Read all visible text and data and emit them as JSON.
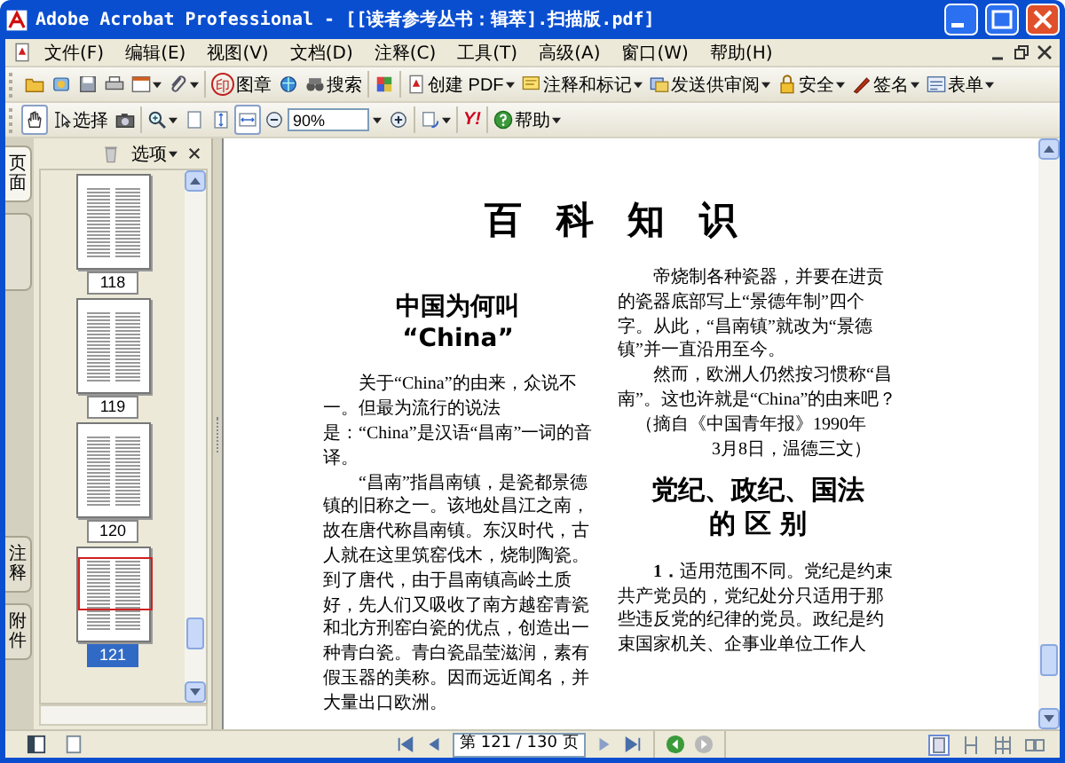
{
  "window": {
    "title": "Adobe Acrobat Professional - [[读者参考丛书：辑萃].扫描版.pdf]"
  },
  "menu_bar": {
    "items": [
      "文件(F)",
      "编辑(E)",
      "视图(V)",
      "文档(D)",
      "注释(C)",
      "工具(T)",
      "高级(A)",
      "窗口(W)",
      "帮助(H)"
    ]
  },
  "toolbar_1": {
    "items": [
      {
        "kind": "icon",
        "dropdown": false
      },
      {
        "kind": "icon",
        "dropdown": false
      },
      {
        "kind": "icon",
        "dropdown": false
      },
      {
        "kind": "icon",
        "dropdown": false
      },
      {
        "kind": "icon",
        "dropdown": true
      },
      {
        "kind": "icon",
        "dropdown": true
      },
      {
        "kind": "separator"
      },
      {
        "kind": "seal",
        "glyph": "印",
        "label": "图章",
        "dropdown": false
      },
      {
        "kind": "icon",
        "dropdown": false
      },
      {
        "kind": "labeled",
        "label": "搜索",
        "dropdown": false
      },
      {
        "kind": "separator"
      },
      {
        "kind": "icon",
        "dropdown": false
      },
      {
        "kind": "separator"
      },
      {
        "kind": "labeled",
        "label": "创建 PDF",
        "dropdown": true
      },
      {
        "kind": "labeled",
        "label": "注释和标记",
        "dropdown": true
      },
      {
        "kind": "labeled",
        "label": "发送供审阅",
        "dropdown": true
      },
      {
        "kind": "labeled",
        "label": "安全",
        "dropdown": true
      },
      {
        "kind": "labeled",
        "label": "签名",
        "dropdown": true
      },
      {
        "kind": "labeled",
        "label": "表单",
        "dropdown": true
      }
    ]
  },
  "toolbar_2": {
    "items": [
      {
        "kind": "icon",
        "dropdown": false,
        "selected": true
      },
      {
        "kind": "labeled",
        "label": "选择",
        "dropdown": false,
        "selected": false
      },
      {
        "kind": "icon",
        "dropdown": false,
        "selected": false
      },
      {
        "kind": "separator"
      },
      {
        "kind": "icon",
        "dropdown": true,
        "selected": false
      },
      {
        "kind": "icon",
        "dropdown": false,
        "selected": false
      },
      {
        "kind": "icon",
        "dropdown": false,
        "selected": false
      },
      {
        "kind": "icon",
        "dropdown": false,
        "selected": true
      },
      {
        "kind": "icon",
        "dropdown": false,
        "selected": false
      },
      {
        "kind": "zoom_field",
        "value": "90%",
        "dropdown": true
      },
      {
        "kind": "icon",
        "dropdown": false,
        "selected": false
      },
      {
        "kind": "separator"
      },
      {
        "kind": "icon",
        "dropdown": true,
        "selected": false
      },
      {
        "kind": "separator"
      },
      {
        "kind": "text_icon",
        "glyph": "Y!"
      },
      {
        "kind": "separator"
      },
      {
        "kind": "labeled",
        "label": "帮助",
        "dropdown": true,
        "selected": false
      }
    ]
  },
  "navigation_panel": {
    "top_tabs": [
      {
        "label": "页面",
        "selected": true
      }
    ],
    "bottom_tabs": [
      {
        "label": "注释",
        "selected": false
      },
      {
        "label": "附件",
        "selected": false
      }
    ],
    "options_label": "选项",
    "thumbnails": [
      {
        "label": "118",
        "selected": false
      },
      {
        "label": "119",
        "selected": false
      },
      {
        "label": "120",
        "selected": false
      },
      {
        "label": "121",
        "selected": true
      }
    ]
  },
  "document": {
    "title": "百 科 知 识",
    "left_column": {
      "heading": [
        "中国为何叫",
        "“China”"
      ],
      "paragraphs": [
        "关于“China”的由来，众说不一。但最为流行的说法是：“China”是汉语“昌南”一词的音译。",
        "“昌南”指昌南镇，是瓷都景德镇的旧称之一。该地处昌江之南，故在唐代称昌南镇。东汉时代，古人就在这里筑窑伐木，烧制陶瓷。到了唐代，由于昌南镇高岭土质好，先人们又吸收了南方越窑青瓷和北方刑窑白瓷的优点，创造出一种青白瓷。青白瓷晶莹滋润，素有假玉器的美称。因而远近闻名，并大量出口欧洲。"
      ]
    },
    "right_column": {
      "paragraphs": [
        "帝烧制各种瓷器，并要在进贡的瓷器底部写上“景德年制”四个字。从此，“昌南镇”就改为“景德镇”并一直沿用至今。",
        "然而，欧洲人仍然按习惯称“昌南”。这也许就是“China”的由来吧？"
      ],
      "citation": [
        "（摘自《中国青年报》1990年",
        "3月8日，温德三文）"
      ],
      "heading": [
        "党纪、政纪、国法",
        "的 区 别"
      ],
      "body": "**1．**适用范围不同。党纪是约束共产党员的，党纪处分只适用于那些违反党的纪律的党员。政纪是约束国家机关、企事业单位工作人"
    }
  },
  "status_bar": {
    "page_field": "第 121 / 130 页"
  }
}
